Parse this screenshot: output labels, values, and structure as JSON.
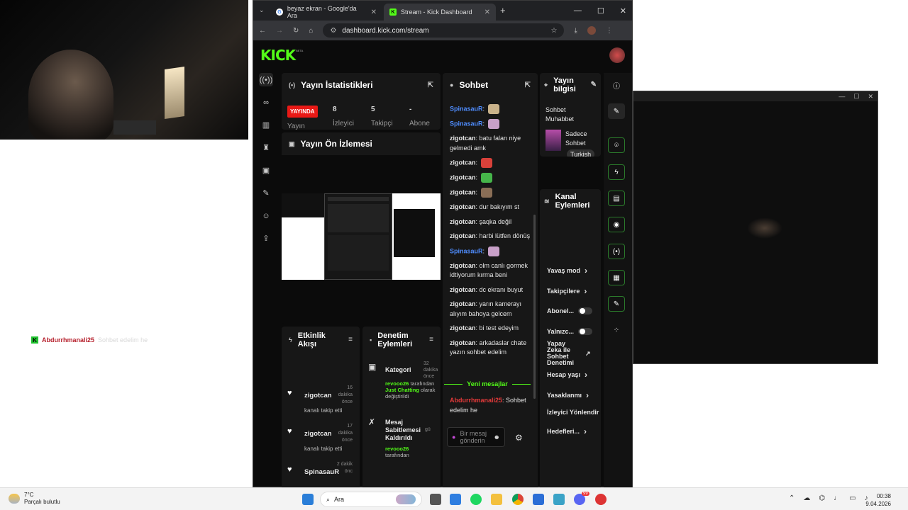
{
  "overlay": {
    "username": "Abdurrhmanali25",
    "message": "Sohbet edelim he"
  },
  "window2": {
    "minimize": "—",
    "maximize": "☐",
    "close": "✕"
  },
  "browser": {
    "tabs": [
      {
        "title": "beyaz ekran - Google'da Ara",
        "close": "✕"
      },
      {
        "title": "Stream - Kick Dashboard",
        "close": "✕"
      }
    ],
    "new_tab": "+",
    "window_controls": {
      "minimize": "—",
      "maximize": "☐",
      "close": "✕"
    },
    "url": "dashboard.kick.com/stream"
  },
  "kick": {
    "logo": "KICK",
    "beta": "BETA",
    "stats_panel": {
      "title": "Yayın İstatistikleri",
      "live_badge": "YAYINDA",
      "live_sub": "Yayın",
      "viewers": {
        "value": "8",
        "label": "İzleyici"
      },
      "followers": {
        "value": "5",
        "label": "Takipçi"
      },
      "subs": {
        "value": "-",
        "label": "Abone"
      }
    },
    "preview_panel": {
      "title": "Yayın Ön İzlemesi"
    },
    "chat_panel": {
      "title": "Sohbet",
      "messages": [
        {
          "user": "SpinasauR",
          "text": "",
          "emote": "#c9b28a",
          "color": "blue"
        },
        {
          "user": "SpinasauR",
          "text": "",
          "emote": "#c8a0c8",
          "color": "blue"
        },
        {
          "user": "zigotcan",
          "text": "batu falan niye gelmedi amk",
          "emote": "",
          "color": "white"
        },
        {
          "user": "zigotcan",
          "text": "",
          "emote": "#d8413a",
          "color": "white"
        },
        {
          "user": "zigotcan",
          "text": "",
          "emote": "#46b54a",
          "color": "white"
        },
        {
          "user": "zigotcan",
          "text": "",
          "emote": "#8a6e56",
          "color": "white"
        },
        {
          "user": "zigotcan",
          "text": "dur bakıyım st",
          "emote": "",
          "color": "white"
        },
        {
          "user": "zigotcan",
          "text": "şaqka değil",
          "emote": "",
          "color": "white"
        },
        {
          "user": "zigotcan",
          "text": "harbi lütfen dönüş",
          "emote": "",
          "color": "white"
        },
        {
          "user": "SpinasauR",
          "text": "",
          "emote": "#c8a0c8",
          "color": "blue"
        },
        {
          "user": "zigotcan",
          "text": "olm canlı gormek idtiyorum kırma beni",
          "emote": "",
          "color": "white"
        },
        {
          "user": "zigotcan",
          "text": "dc ekranı buyut",
          "emote": "",
          "color": "white"
        },
        {
          "user": "zigotcan",
          "text": "yarın kamerayı alıyım bahoya gelcem",
          "emote": "",
          "color": "white"
        },
        {
          "user": "zigotcan",
          "text": "bi test edeyim",
          "emote": "",
          "color": "white"
        },
        {
          "user": "zigotcan",
          "text": "arkadaslar chate yazın sohbet edelim",
          "emote": "",
          "color": "white"
        }
      ],
      "new_messages": "Yeni mesajlar",
      "last_message": {
        "user": "Abdurrhmanali25",
        "text": "Sohbet edelim he"
      },
      "input_placeholder": "Bir mesaj gönderin"
    },
    "info_panel": {
      "title": "Yayın bilgisi",
      "stream_title": "Sohbet Muhabbet",
      "category": "Sadece Sohbet",
      "tag": "Turkish"
    },
    "channel_actions": {
      "title": "Kanal Eylemleri",
      "items": [
        {
          "label": "Yavaş mod",
          "type": "chevron"
        },
        {
          "label": "Takipçilere",
          "type": "chevron"
        },
        {
          "label": "Abonel...",
          "type": "toggle"
        },
        {
          "label": "Yalnızc...",
          "type": "toggle"
        },
        {
          "label": "Yapay Zeka ile Sohbet Denetimi",
          "type": "link"
        },
        {
          "label": "Hesap yaşı",
          "type": "chevron"
        },
        {
          "label": "Yasaklanmı",
          "type": "chevron"
        },
        {
          "label": "İzleyici Yönlendir",
          "type": "none"
        },
        {
          "label": "Hedefleri...",
          "type": "chevron"
        }
      ]
    },
    "activity_panel": {
      "title": "Etkinlik Akışı",
      "items": [
        {
          "user": "zigotcan",
          "time": "16 dakika önce",
          "action": "kanalı takip etti"
        },
        {
          "user": "zigotcan",
          "time": "17 dakika önce",
          "action": "kanalı takip etti"
        },
        {
          "user": "SpinasauR",
          "time": "2 dakik önc",
          "action": ""
        }
      ]
    },
    "mod_panel": {
      "title": "Denetim Eylemleri",
      "items": [
        {
          "title": "Kategori",
          "time": "32 dakika önce",
          "by": "revooo26",
          "detail1": "tarafından",
          "highlight": "Just Chatting",
          "detail2": "olarak değiştirildi"
        },
        {
          "title": "Mesaj Sabitlemesi Kaldırıldı",
          "time": "gü",
          "by": "revooo26",
          "detail1": "tarafından",
          "highlight": "",
          "detail2": ""
        }
      ]
    }
  },
  "taskbar": {
    "weather_temp": "7°C",
    "weather_desc": "Parçalı bulutlu",
    "search_label": "Ara",
    "time": "00:38",
    "date": "9.04.2026",
    "discord_badge": "99"
  }
}
